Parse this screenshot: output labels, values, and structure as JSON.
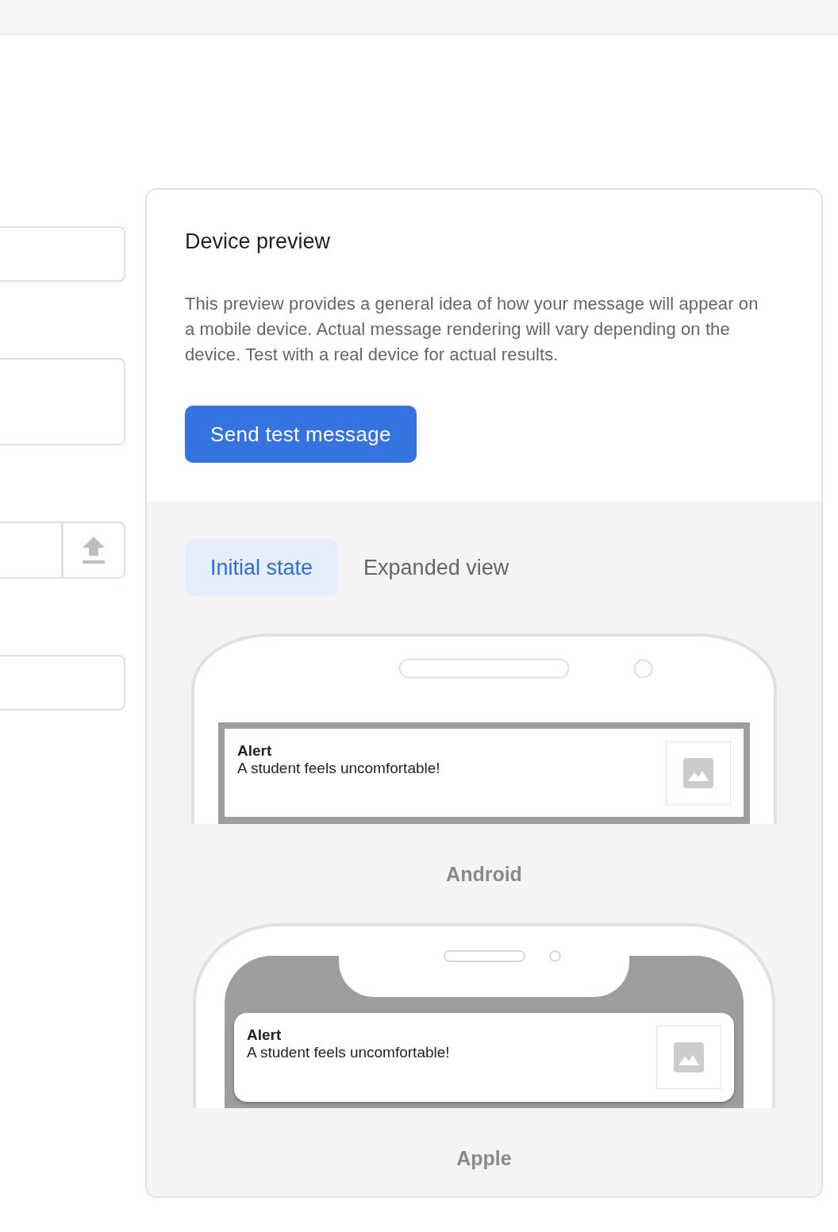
{
  "form_fields": [
    {
      "kind": "text"
    },
    {
      "kind": "textarea"
    },
    {
      "kind": "file"
    },
    {
      "kind": "text"
    }
  ],
  "preview": {
    "title": "Device preview",
    "description": "This preview provides a general idea of how your message will appear on a mobile device. Actual message rendering will vary depending on the device. Test with a real device for actual results.",
    "send_button": "Send test message",
    "tabs": [
      {
        "label": "Initial state",
        "selected": true
      },
      {
        "label": "Expanded view",
        "selected": false
      }
    ],
    "devices": [
      {
        "kind": "android",
        "label": "Android",
        "notification": {
          "title": "Alert",
          "body": "A student feels uncomfortable!"
        }
      },
      {
        "kind": "apple",
        "label": "Apple",
        "notification": {
          "title": "Alert",
          "body": "A student feels uncomfortable!"
        }
      }
    ]
  }
}
